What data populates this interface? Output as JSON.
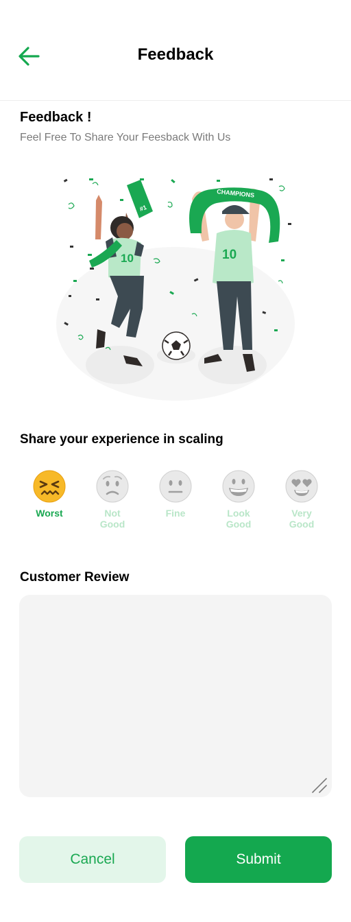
{
  "header": {
    "title": "Feedback",
    "back_icon": "arrow-left-icon"
  },
  "intro": {
    "title": "Feedback !",
    "subtitle": "Feel Free To Share Your Feesback With Us"
  },
  "illustration": {
    "banner_text": "CHAMPIONS",
    "jersey_number": "10",
    "foam_finger_text": "#1"
  },
  "rating": {
    "title": "Share your experience in scaling",
    "selected": "Worst",
    "options": [
      {
        "label": "Worst",
        "icon": "confounded-face-icon"
      },
      {
        "label": "Not Good",
        "icon": "frowning-face-icon"
      },
      {
        "label": "Fine",
        "icon": "neutral-face-icon"
      },
      {
        "label": "Look Good",
        "icon": "grinning-face-icon"
      },
      {
        "label": "Very Good",
        "icon": "heart-eyes-face-icon"
      }
    ]
  },
  "review": {
    "title": "Customer Review",
    "value": "",
    "placeholder": ""
  },
  "actions": {
    "cancel_label": "Cancel",
    "submit_label": "Submit"
  },
  "colors": {
    "accent": "#14a84f",
    "accent_light": "#e3f6ea",
    "inactive_label": "#b9e6c8"
  }
}
